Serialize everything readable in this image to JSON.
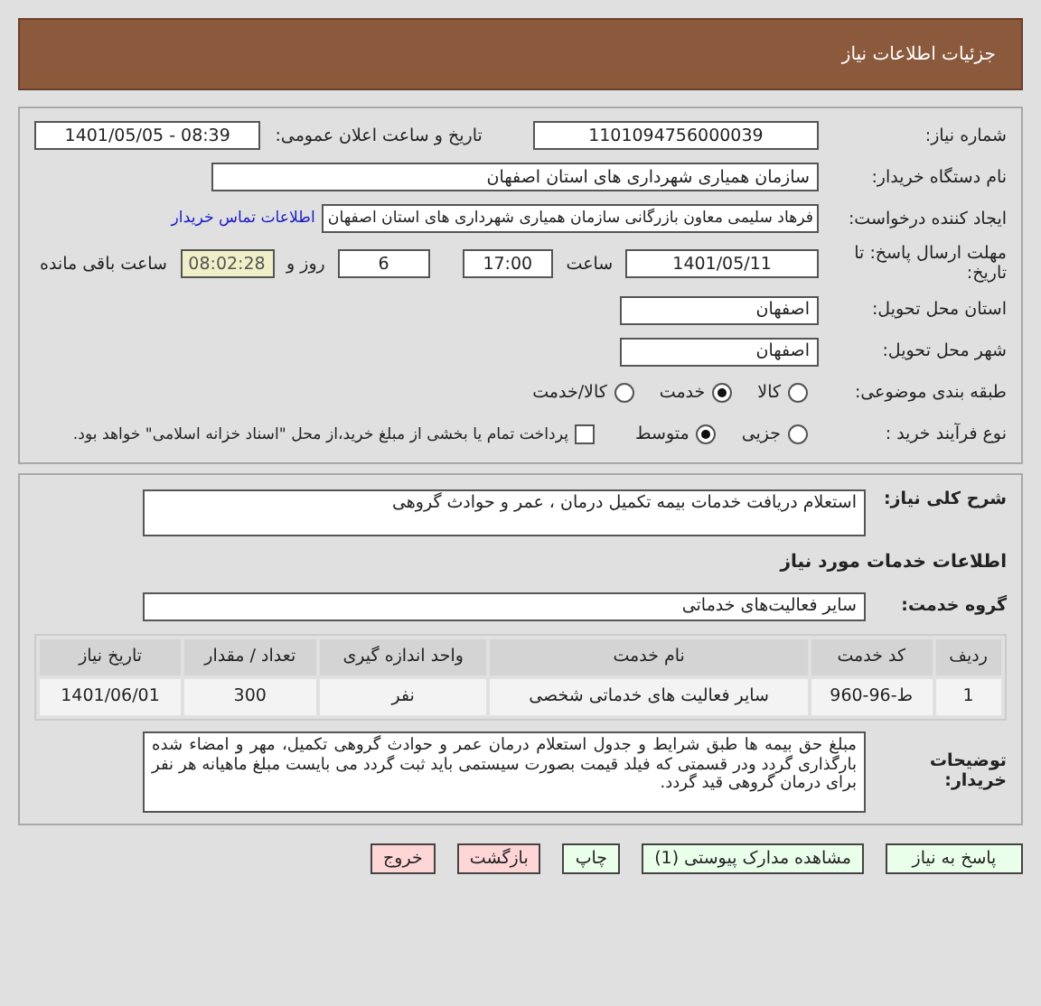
{
  "header": {
    "title": "جزئیات اطلاعات نیاز"
  },
  "details": {
    "need_number": {
      "label": "شماره نیاز:",
      "value": "1101094756000039"
    },
    "announce": {
      "label": "تاریخ و ساعت اعلان عمومی:",
      "value": "1401/05/05 - 08:39"
    },
    "buyer": {
      "label": "نام دستگاه خریدار:",
      "value": "سازمان همیاری شهرداری های استان اصفهان"
    },
    "creator": {
      "label": "ایجاد کننده درخواست:",
      "value": "فرهاد  سلیمی  معاون بازرگانی  سازمان همیاری شهرداری های استان اصفهان",
      "link": "اطلاعات تماس خریدار"
    },
    "deadline": {
      "label": "مهلت ارسال پاسخ: تا تاریخ:",
      "date": "1401/05/11",
      "time_label": "ساعت",
      "time": "17:00",
      "days": "6",
      "days_label": "روز و",
      "remaining": "08:02:28",
      "remaining_label": "ساعت باقی مانده"
    },
    "province": {
      "label": "استان محل تحویل:",
      "value": "اصفهان"
    },
    "city": {
      "label": "شهر محل تحویل:",
      "value": "اصفهان"
    },
    "category": {
      "label": "طبقه بندی موضوعی:",
      "options": [
        {
          "label": "کالا",
          "selected": false
        },
        {
          "label": "خدمت",
          "selected": true
        },
        {
          "label": "کالا/خدمت",
          "selected": false
        }
      ]
    },
    "process": {
      "label": "نوع فرآیند خرید :",
      "options": [
        {
          "label": "جزیی",
          "selected": false
        },
        {
          "label": "متوسط",
          "selected": true
        }
      ],
      "payment": {
        "label": "پرداخت تمام یا بخشی از مبلغ خرید،از محل \"اسناد خزانه اسلامی\" خواهد بود.",
        "checked": false
      }
    }
  },
  "summary": {
    "label": "شرح کلی نیاز:",
    "value": "استعلام دریافت خدمات بیمه تکمیل درمان ، عمر و حوادث گروهی"
  },
  "services_heading": "اطلاعات خدمات مورد نیاز",
  "service_group": {
    "label": "گروه خدمت:",
    "value": "سایر فعالیت‌های خدماتی"
  },
  "table": {
    "columns": [
      "ردیف",
      "کد خدمت",
      "نام خدمت",
      "واحد اندازه گیری",
      "تعداد / مقدار",
      "تاریخ نیاز"
    ],
    "rows": [
      [
        "1",
        "ط-96-960",
        "سایر فعالیت های خدماتی شخصی",
        "نفر",
        "300",
        "1401/06/01"
      ]
    ]
  },
  "buyer_notes": {
    "label": "توضیحات خریدار:",
    "value": "مبلغ حق بیمه ها  طبق شرایط و جدول استعلام درمان عمر و حوادث گروهی تکمیل، مهر و امضاء شده بارگذاری گردد ودر قسمتی که فیلد قیمت بصورت سیستمی باید ثبت گردد می بایست مبلغ  ماهیانه هر نفر برای درمان گروهی قید گردد."
  },
  "buttons": [
    {
      "label": "پاسخ به نیاز",
      "kind": "action"
    },
    {
      "label": "مشاهده مدارک پیوستی (1)",
      "kind": "action"
    },
    {
      "label": "چاپ",
      "kind": "action"
    },
    {
      "label": "بازگشت",
      "kind": "exit"
    },
    {
      "label": "خروج",
      "kind": "exit"
    }
  ]
}
